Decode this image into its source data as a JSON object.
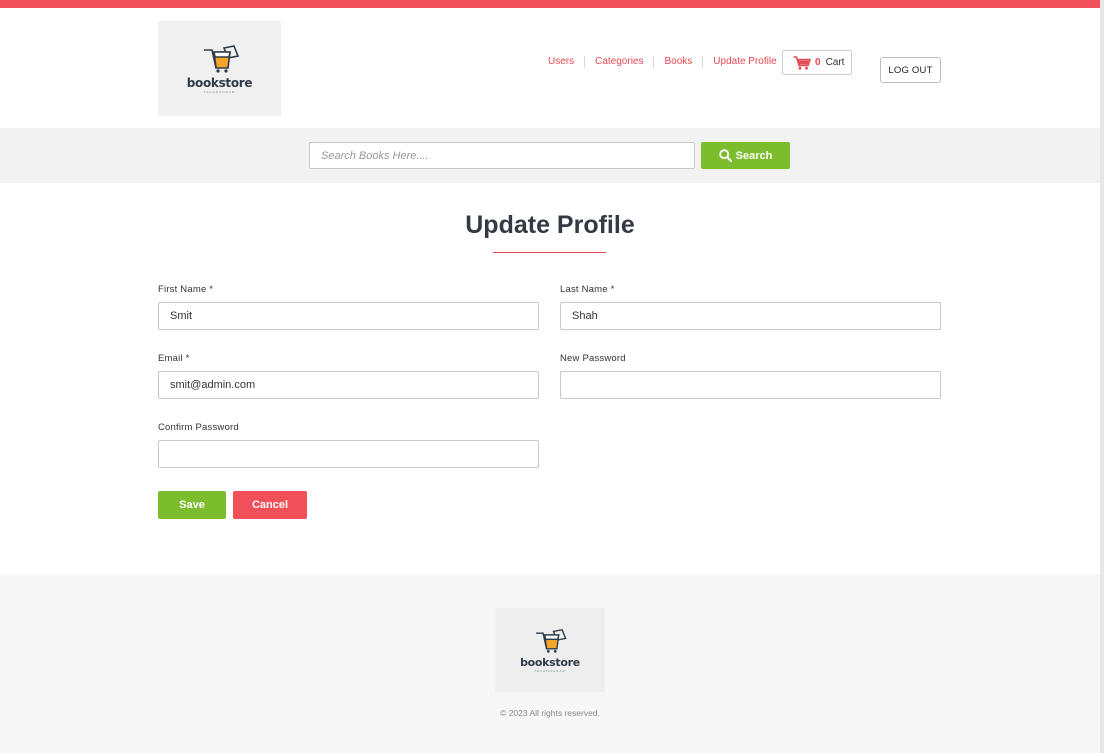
{
  "brand": {
    "logo_text": "bookstore",
    "logo_sub": "TECHNOGRAM",
    "accent_color": "#f15058",
    "green_color": "#7cbd2e"
  },
  "nav": {
    "items": [
      {
        "label": "Users"
      },
      {
        "label": "Categories"
      },
      {
        "label": "Books"
      },
      {
        "label": "Update Profile"
      }
    ],
    "cart": {
      "count": "0",
      "label": "Cart",
      "icon": "cart-icon"
    },
    "logout_label": "LOG OUT"
  },
  "search": {
    "placeholder": "Search Books Here....",
    "value": "",
    "button_label": "Search",
    "icon": "search-icon"
  },
  "main": {
    "title": "Update Profile",
    "fields": {
      "first_name": {
        "label": "First Name *",
        "value": "Smit"
      },
      "last_name": {
        "label": "Last Name *",
        "value": "Shah"
      },
      "email": {
        "label": "Email *",
        "value": "smit@admin.com"
      },
      "new_password": {
        "label": "New Password",
        "value": ""
      },
      "confirm_password": {
        "label": "Confirm Password",
        "value": ""
      }
    },
    "save_label": "Save",
    "cancel_label": "Cancel"
  },
  "footer": {
    "copyright": "© 2023 All rights reserved."
  }
}
